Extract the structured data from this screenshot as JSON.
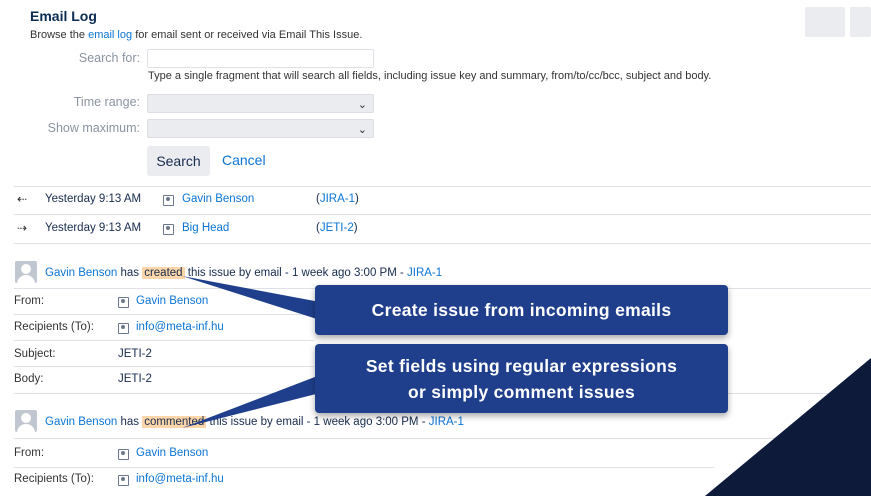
{
  "header": {
    "title": "Email Log",
    "subtitle_before": "Browse the",
    "subtitle_link": "email log",
    "subtitle_after": "for email sent or received via Email This Issue."
  },
  "filters": {
    "search_label": "Search for:",
    "search_value": "",
    "search_hint": "Type a single fragment that will search all fields, including issue key and summary, from/to/cc/bcc, subject and body.",
    "time_range_label": "Time range:",
    "time_range_value": "",
    "show_max_label": "Show maximum:",
    "show_max_value": "",
    "search_button": "Search",
    "cancel_button": "Cancel"
  },
  "log_rows": [
    {
      "direction_icon": "incoming-icon",
      "glyph": "⇠",
      "time": "Yesterday 9:13 AM",
      "user": "Gavin Benson",
      "issue_open": "(",
      "issue_key": "JIRA-1",
      "issue_close": ")"
    },
    {
      "direction_icon": "outgoing-icon",
      "glyph": "⇢",
      "time": "Yesterday 9:13 AM",
      "user": "Big Head",
      "issue_open": "(",
      "issue_key": "JETI-2",
      "issue_close": ")"
    }
  ],
  "activity": [
    {
      "user": "Gavin Benson",
      "verb_before": "has",
      "action": "created",
      "verb_after": "this issue by email - 1 week ago 3:00 PM -",
      "issue_key": "JIRA-1",
      "from_label": "From:",
      "from_value": "Gavin Benson",
      "to_label": "Recipients (To):",
      "to_value": "info@meta-inf.hu",
      "subject_label": "Subject:",
      "subject_value": "JETI-2",
      "body_label": "Body:",
      "body_value": "JETI-2"
    },
    {
      "user": "Gavin Benson",
      "verb_before": "has",
      "action": "commented",
      "verb_after": "this issue by email - 1 week ago 3:00 PM -",
      "issue_key": "JIRA-1",
      "from_label": "From:",
      "from_value": "Gavin Benson",
      "to_label": "Recipients (To):",
      "to_value": "info@meta-inf.hu"
    }
  ],
  "callouts": {
    "first": "Create issue from incoming emails",
    "second_line1": "Set fields using regular expressions",
    "second_line2": "or simply comment issues"
  },
  "colors": {
    "callout_bg": "#1f3f8c",
    "link": "#0b74d6",
    "highlight": "#fcd6a9",
    "corner_shape": "#0e1a3a"
  }
}
